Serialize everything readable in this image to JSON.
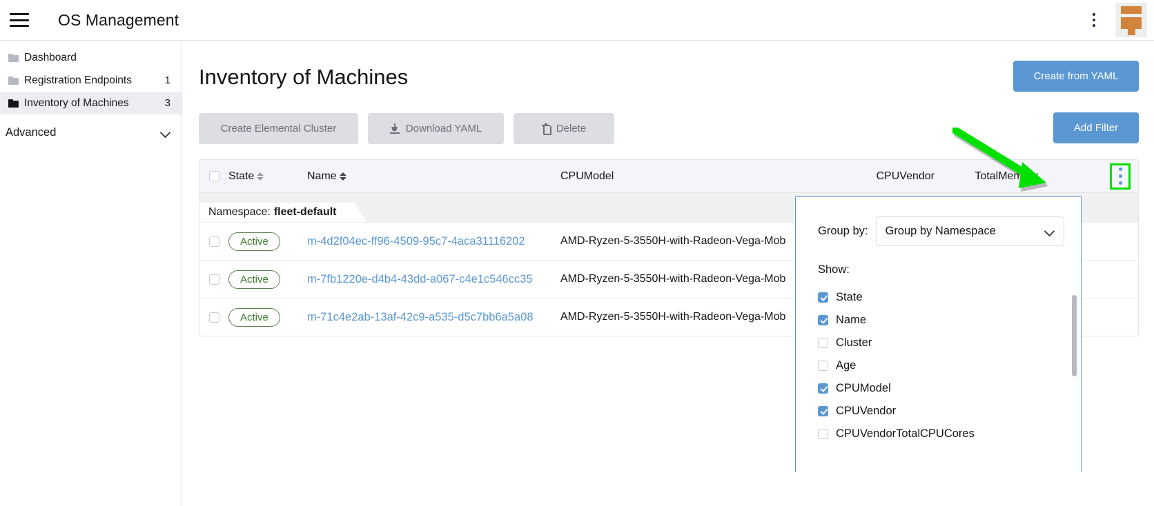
{
  "topbar": {
    "app_title": "OS Management",
    "menu_icon": "hamburger-icon",
    "kebab_icon": "kebab-menu-icon",
    "avatar_icon": "user-avatar-icon"
  },
  "sidebar": {
    "items": [
      {
        "label": "Dashboard",
        "count": "",
        "icon": "folder-icon",
        "active": false
      },
      {
        "label": "Registration Endpoints",
        "count": "1",
        "icon": "folder-icon",
        "active": false
      },
      {
        "label": "Inventory of Machines",
        "count": "3",
        "icon": "folder-icon",
        "active": true
      }
    ],
    "group": {
      "label": "Advanced",
      "icon": "chevron-down-icon"
    }
  },
  "main": {
    "page_title": "Inventory of Machines",
    "create_from_yaml_label": "Create from YAML",
    "add_filter_label": "Add Filter",
    "toolbar": {
      "create_cluster_label": "Create Elemental Cluster",
      "download_yaml_label": "Download YAML",
      "delete_label": "Delete"
    },
    "table": {
      "columns": {
        "state": "State",
        "name": "Name",
        "cpumodel": "CPUModel",
        "cpuvendor": "CPUVendor",
        "totalmemory": "TotalMemory"
      },
      "group_label": "Namespace:",
      "group_value": "fleet-default",
      "rows": [
        {
          "state": "Active",
          "name": "m-4d2f04ec-ff96-4509-95c7-4aca31116202",
          "cpumodel": "AMD-Ryzen-5-3550H-with-Radeon-Vega-Mob"
        },
        {
          "state": "Active",
          "name": "m-7fb1220e-d4b4-43dd-a067-c4e1c546cc35",
          "cpumodel": "AMD-Ryzen-5-3550H-with-Radeon-Vega-Mob"
        },
        {
          "state": "Active",
          "name": "m-71c4e2ab-13af-42c9-a535-d5c7bb6a5a08",
          "cpumodel": "AMD-Ryzen-5-3550H-with-Radeon-Vega-Mob"
        }
      ]
    }
  },
  "dropdown": {
    "group_by_label": "Group by:",
    "group_by_value": "Group by Namespace",
    "show_label": "Show:",
    "options": [
      {
        "label": "State",
        "checked": true
      },
      {
        "label": "Name",
        "checked": true
      },
      {
        "label": "Cluster",
        "checked": false
      },
      {
        "label": "Age",
        "checked": false
      },
      {
        "label": "CPUModel",
        "checked": true
      },
      {
        "label": "CPUVendor",
        "checked": true
      },
      {
        "label": "CPUVendorTotalCPUCores",
        "checked": false
      }
    ]
  },
  "colors": {
    "accent": "#5b97d2",
    "highlight": "#00e000",
    "muted_button": "#dcdee4",
    "active_badge": "#3d7a2f",
    "brand_orange": "#d2833c"
  }
}
